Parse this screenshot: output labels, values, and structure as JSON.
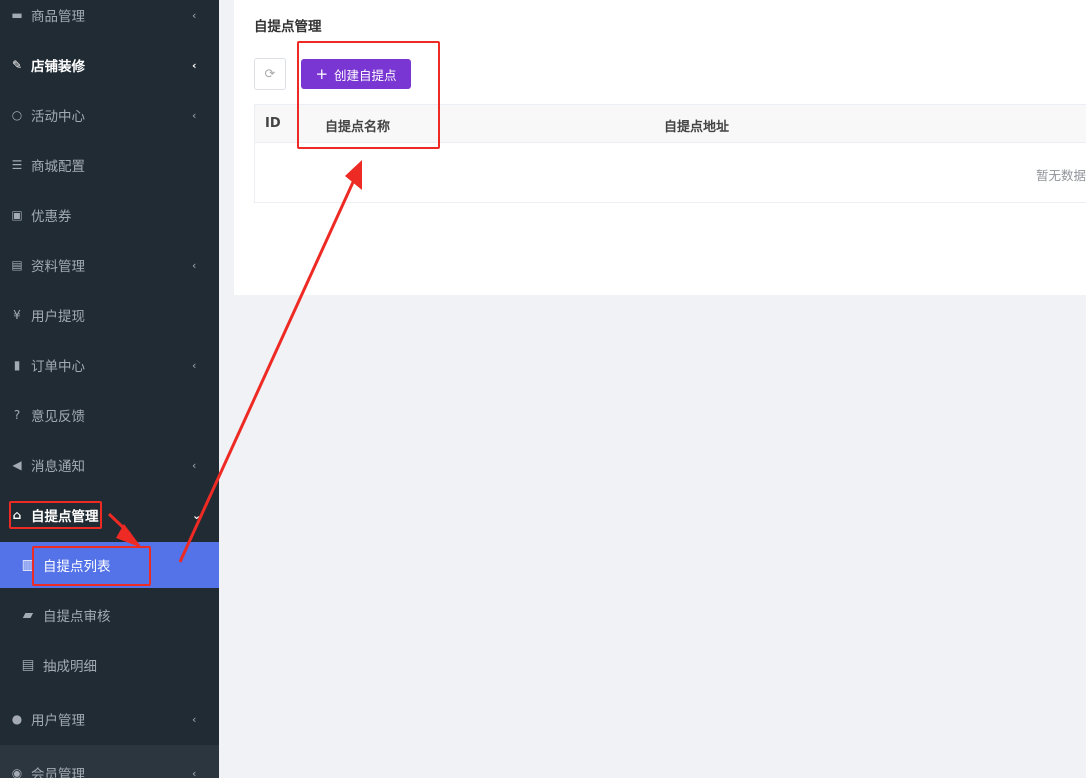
{
  "sidebar": {
    "items": [
      {
        "label": "商品管理",
        "icon": "archive-icon",
        "chevron": "‹"
      },
      {
        "label": "店铺装修",
        "icon": "brush-icon",
        "chevron": "‹"
      },
      {
        "label": "活动中心",
        "icon": "circle-icon",
        "chevron": "‹"
      },
      {
        "label": "商城配置",
        "icon": "sliders-icon",
        "chevron": ""
      },
      {
        "label": "优惠券",
        "icon": "money-icon",
        "chevron": ""
      },
      {
        "label": "资料管理",
        "icon": "document-icon",
        "chevron": "‹"
      },
      {
        "label": "用户提现",
        "icon": "yen-icon",
        "chevron": ""
      },
      {
        "label": "订单中心",
        "icon": "file-icon",
        "chevron": "‹"
      },
      {
        "label": "意见反馈",
        "icon": "question-icon",
        "chevron": ""
      },
      {
        "label": "消息通知",
        "icon": "bullhorn-icon",
        "chevron": "‹"
      },
      {
        "label": "自提点管理",
        "icon": "bank-icon",
        "chevron": "⌄"
      }
    ],
    "subitems": [
      {
        "label": "自提点列表",
        "icon": "building-icon"
      },
      {
        "label": "自提点审核",
        "icon": "book-icon"
      },
      {
        "label": "抽成明细",
        "icon": "file-text-icon"
      }
    ],
    "after": [
      {
        "label": "用户管理",
        "icon": "user-icon",
        "chevron": "‹"
      },
      {
        "label": "会员管理",
        "icon": "user-circle-icon",
        "chevron": "‹"
      }
    ]
  },
  "main": {
    "title": "自提点管理",
    "refresh_icon": "refresh-icon",
    "create_label": "创建自提点",
    "table": {
      "columns": [
        "ID",
        "自提点名称",
        "自提点地址"
      ],
      "empty_text": "暂无数据"
    }
  },
  "colors": {
    "sidebar_bg": "#202b33",
    "active_bg": "#5473e8",
    "primary": "#7a36d2",
    "annotation": "#ee2a24"
  }
}
